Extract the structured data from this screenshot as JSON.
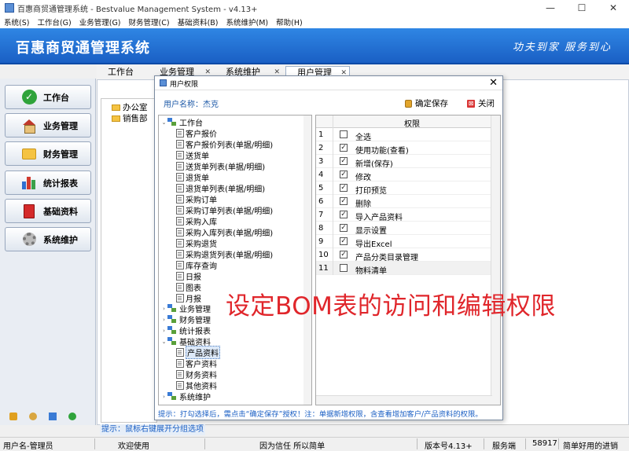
{
  "window": {
    "title": "百惠商贸通管理系统 - Bestvalue Management System - v4.13+",
    "controls": [
      "—",
      "☐",
      "✕"
    ]
  },
  "menu": [
    "系统(S)",
    "工作台(G)",
    "业务管理(G)",
    "财务管理(C)",
    "基础资料(B)",
    "系统维护(M)",
    "帮助(H)"
  ],
  "header": {
    "title": "百惠商贸通管理系统",
    "slogan": "功夫到家 服务到心"
  },
  "nav": [
    "工作台",
    "业务管理",
    "财务管理",
    "统计报表",
    "基础资料",
    "系统维护"
  ],
  "tabs": [
    {
      "label": "工作台"
    },
    {
      "label": "业务管理"
    },
    {
      "label": "系统维护"
    },
    {
      "label": "用户管理"
    }
  ],
  "departments": [
    "办公室",
    "销售部"
  ],
  "hint": "提示：鼠标右键展开分组选项",
  "status": {
    "user": "用户名-管理员",
    "welcome": "欢迎使用",
    "motto": "因为信任 所以简单",
    "version": "版本号4.13+",
    "side": "服务端",
    "code": "58917",
    "tagline": "简单好用的进销"
  },
  "dialog": {
    "title": "用户权限",
    "user_label": "用户名称：杰克",
    "save": "确定保存",
    "close": "关闭",
    "tip": "提示：打勾选择后，需点击“确定保存”授权！注：单据新增权限，含查看增加客户/产品资料的权限。",
    "tree": {
      "workbench": "工作台",
      "workbench_items": [
        "客户报价",
        "客户报价列表(单据/明细)",
        "送货单",
        "送货单列表(单据/明细)",
        "退货单",
        "退货单列表(单据/明细)",
        "采购订单",
        "采购订单列表(单据/明细)",
        "采购入库",
        "采购入库列表(单据/明细)",
        "采购退货",
        "采购退货列表(单据/明细)",
        "库存查询",
        "日报",
        "图表",
        "月报"
      ],
      "business": "业务管理",
      "finance": "财务管理",
      "reports": "统计报表",
      "basic": "基础资料",
      "basic_items": [
        "产品资料",
        "客户资料",
        "财务资料",
        "其他资料"
      ],
      "maintenance": "系统维护"
    },
    "perm_header": "权限",
    "permissions": [
      {
        "no": "1",
        "label": "全选",
        "checked": false
      },
      {
        "no": "2",
        "label": "使用功能(查看)",
        "checked": true
      },
      {
        "no": "3",
        "label": "新增(保存)",
        "checked": true
      },
      {
        "no": "4",
        "label": "修改",
        "checked": true
      },
      {
        "no": "5",
        "label": "打印预览",
        "checked": true
      },
      {
        "no": "6",
        "label": "删除",
        "checked": true
      },
      {
        "no": "7",
        "label": "导入产品资料",
        "checked": true
      },
      {
        "no": "8",
        "label": "显示设置",
        "checked": true
      },
      {
        "no": "9",
        "label": "导出Excel",
        "checked": true
      },
      {
        "no": "10",
        "label": "产品分类目录管理",
        "checked": true
      },
      {
        "no": "11",
        "label": "物料清单",
        "checked": false
      }
    ]
  },
  "overlay_text": "设定BOM表的访问和编辑权限",
  "colors": {
    "header_blue": "#1a5fc4",
    "overlay_red": "#e0262b",
    "hint_blue": "#1a5fc4"
  }
}
